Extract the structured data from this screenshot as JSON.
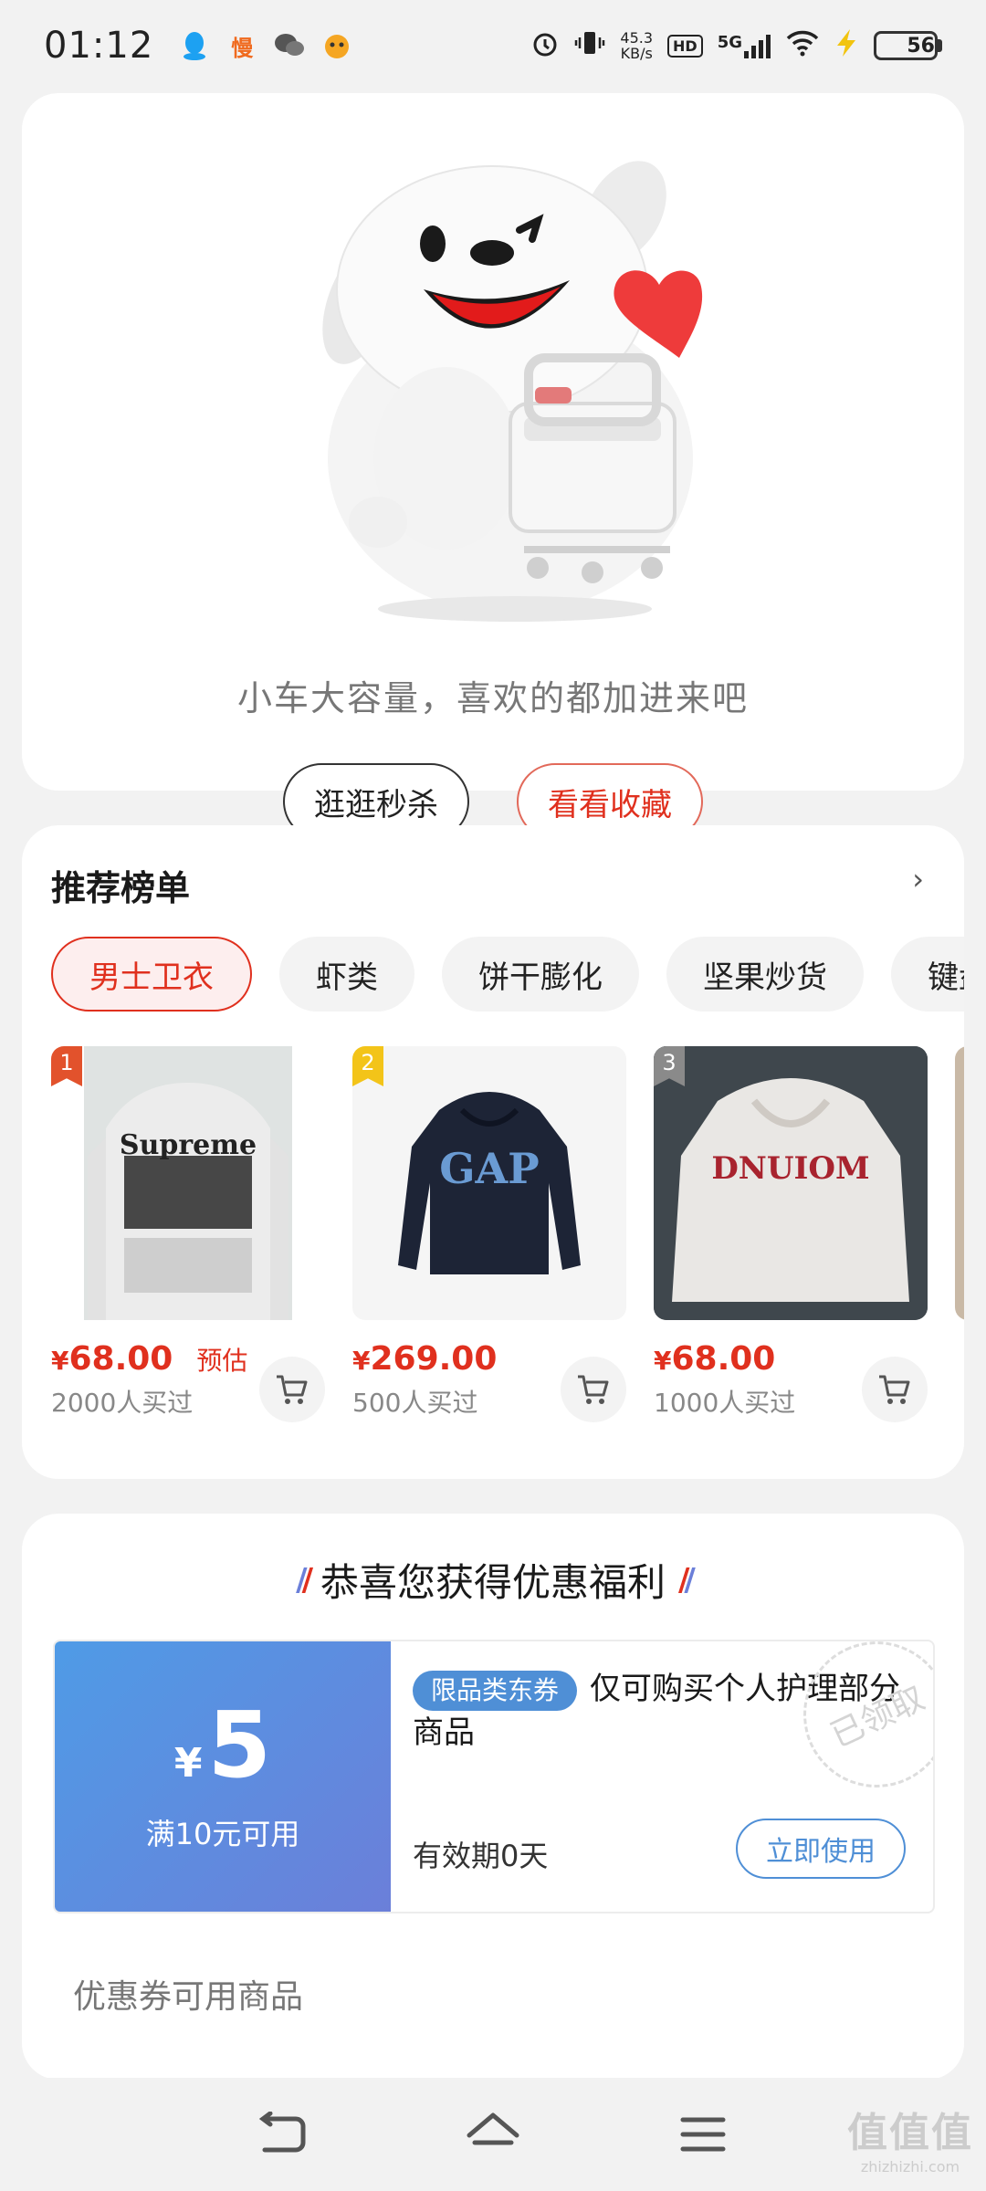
{
  "status_bar": {
    "time": "01:12",
    "apps": [
      {
        "icon": "qq-icon",
        "glyph": "",
        "color": "#1da1f2"
      },
      {
        "icon": "man-app-icon",
        "glyph": "慢",
        "color": "#f06a1e"
      },
      {
        "icon": "wechat-icon",
        "glyph": "",
        "color": "#555555"
      },
      {
        "icon": "game-icon",
        "glyph": "",
        "color": "#f5a623"
      }
    ],
    "net_speed_value": "45.3",
    "net_speed_unit": "KB/s",
    "hd": "HD",
    "signal": "5G",
    "battery": "56",
    "battery_level": 0.56
  },
  "empty_cart": {
    "message": "小车大容量，喜欢的都加进来吧",
    "browse_flash_sale": "逛逛秒杀",
    "view_favorites": "看看收藏"
  },
  "ranking": {
    "title": "推荐榜单",
    "arrow": "›",
    "tabs": [
      "男士卫衣",
      "虾类",
      "饼干膨化",
      "坚果炒货",
      "键盘"
    ],
    "products": [
      {
        "rank": "1",
        "price_symbol": "¥",
        "price": "68.00",
        "tag": "预估",
        "sold": "2000人买过",
        "print_text": "Supreme",
        "colors": {
          "badge": "#e2522c"
        }
      },
      {
        "rank": "2",
        "price_symbol": "¥",
        "price": "269.00",
        "tag": "",
        "sold": "500人买过",
        "print_text": "GAP",
        "colors": {
          "badge": "#f3c419"
        }
      },
      {
        "rank": "3",
        "price_symbol": "¥",
        "price": "68.00",
        "tag": "",
        "sold": "1000人买过",
        "print_text": "DNUIOM",
        "colors": {
          "badge": "#8a8a8a"
        }
      }
    ]
  },
  "coupon": {
    "heading": "恭喜您获得优惠福利",
    "amount_symbol": "¥",
    "amount": "5",
    "condition": "满10元可用",
    "category_tag": "限品类东券",
    "description": "仅可购买个人护理部分商品",
    "validity": "有效期0天",
    "use_button": "立即使用",
    "stamp": "已领取",
    "usable_products_title": "优惠券可用商品"
  },
  "nav": {
    "back": "back-icon",
    "home": "home-icon",
    "menu": "menu-icon"
  },
  "watermark": {
    "main": "值值值",
    "sub": "zhizhizhi.com"
  },
  "colors": {
    "accent_red": "#e0301e",
    "coupon_blue": "#4f8fd6"
  }
}
